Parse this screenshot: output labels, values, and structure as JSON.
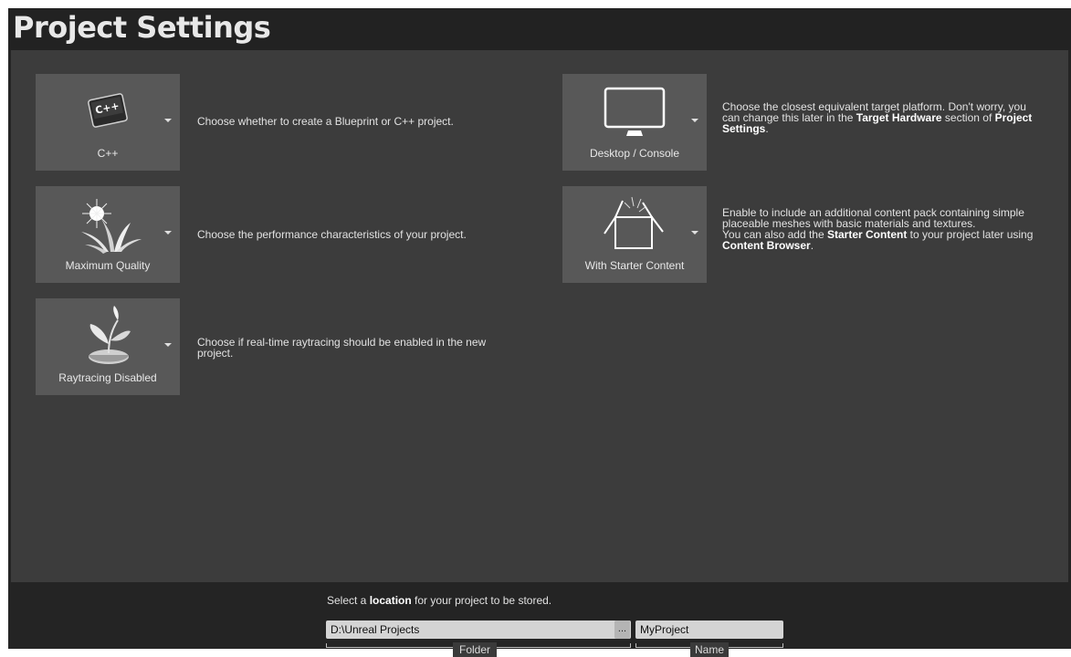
{
  "window": {
    "title": "Project Settings"
  },
  "options": {
    "project_type": {
      "label": "C++",
      "icon_text": "C++",
      "description": "Choose whether to create a Blueprint or C++ project."
    },
    "quality": {
      "label": "Maximum Quality",
      "description": "Choose the performance characteristics of your project."
    },
    "raytracing": {
      "label": "Raytracing Disabled",
      "description_line1": "Choose if real-time raytracing should be enabled in the new",
      "description_line2": "project."
    },
    "platform": {
      "label": "Desktop / Console",
      "desc_line1": "Choose the closest equivalent target platform. Don't worry, you",
      "desc_line2_a": "can change this later in the ",
      "desc_line2_b": "Target Hardware",
      "desc_line2_c": " section of ",
      "desc_line2_d": "Project",
      "desc_line3": "Settings",
      "desc_line3_end": "."
    },
    "starter_content": {
      "label": "With Starter Content",
      "desc_line1": "Enable to include an additional content pack containing simple",
      "desc_line2": "placeable meshes with basic materials and textures.",
      "desc_line3_a": "You can also add the ",
      "desc_line3_b": "Starter Content",
      "desc_line3_c": " to your project later using",
      "desc_line4": "Content Browser",
      "desc_line4_end": "."
    }
  },
  "footer": {
    "location_prefix": "Select a ",
    "location_bold": "location",
    "location_suffix": " for your project to be stored.",
    "folder_value": "D:\\Unreal Projects",
    "browse_label": "...",
    "name_value": "MyProject",
    "folder_caption": "Folder",
    "name_caption": "Name"
  },
  "colors": {
    "background": "#242424",
    "panel": "#3c3c3c",
    "tile": "#585858",
    "field": "#d4d4d4"
  }
}
